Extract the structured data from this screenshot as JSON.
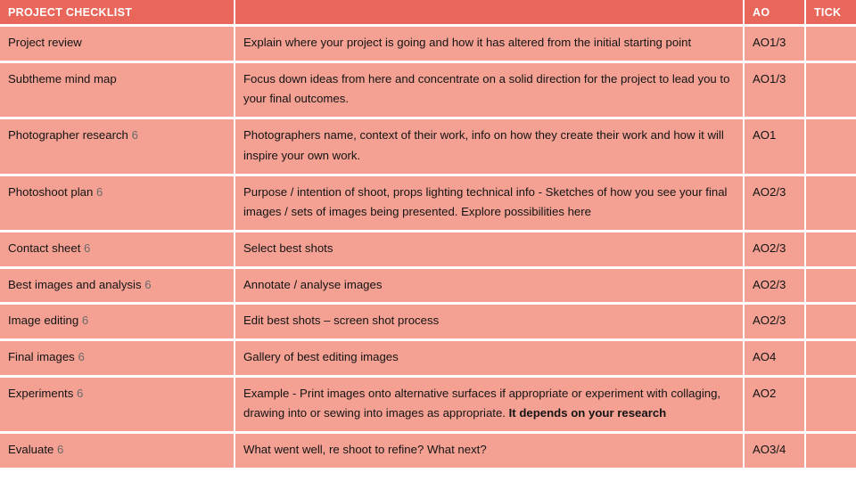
{
  "table": {
    "headers": {
      "task": "PROJECT CHECKLIST",
      "description": "",
      "ao": "AO",
      "tick": "TICK"
    },
    "colors": {
      "header_background": "#e8675a",
      "row_background": "#f4a193",
      "gridline": "#ffffff",
      "header_text": "#ffffff",
      "body_text": "#141414"
    },
    "rows": [
      {
        "task": "Project review",
        "marker": "",
        "description": "Explain where your project is going and how it has altered from the initial starting point",
        "description_bold": "",
        "ao": "AO1/3",
        "tick": ""
      },
      {
        "task": "Subtheme mind map",
        "marker": "",
        "description": "Focus down ideas from here and concentrate on a solid direction for the project to lead you to your final outcomes.",
        "description_bold": "",
        "ao": "AO1/3",
        "tick": ""
      },
      {
        "task": "Photographer research",
        "marker": "6",
        "description": "Photographers name, context of their work, info on how they create their work and how it will inspire your own work.",
        "description_bold": "",
        "ao": "AO1",
        "tick": ""
      },
      {
        "task": "Photoshoot plan",
        "marker": "6",
        "description": "Purpose / intention of shoot, props lighting technical info - Sketches of how you see your final images / sets of images being presented.  Explore possibilities here",
        "description_bold": "",
        "ao": "AO2/3",
        "tick": ""
      },
      {
        "task": "Contact sheet",
        "marker": "6",
        "description": "Select best shots",
        "description_bold": "",
        "ao": "AO2/3",
        "tick": ""
      },
      {
        "task": "Best images and analysis",
        "marker": "6",
        "description": "Annotate / analyse images",
        "description_bold": "",
        "ao": "AO2/3",
        "tick": ""
      },
      {
        "task": "Image editing",
        "marker": "6",
        "description": "Edit best shots – screen shot process",
        "description_bold": "",
        "ao": "AO2/3",
        "tick": ""
      },
      {
        "task": "Final images",
        "marker": "6",
        "description": "Gallery of best editing images",
        "description_bold": "",
        "ao": "AO4",
        "tick": ""
      },
      {
        "task": "Experiments",
        "marker": "6",
        "description": "Example - Print images onto alternative surfaces if appropriate or experiment with collaging, drawing into or sewing into images as appropriate. ",
        "description_bold": "It depends on your research",
        "ao": "AO2",
        "tick": ""
      },
      {
        "task": "Evaluate ",
        "marker": "6",
        "description": "What went well, re shoot to refine? What next?",
        "description_bold": "",
        "ao": "AO3/4",
        "tick": ""
      }
    ]
  }
}
